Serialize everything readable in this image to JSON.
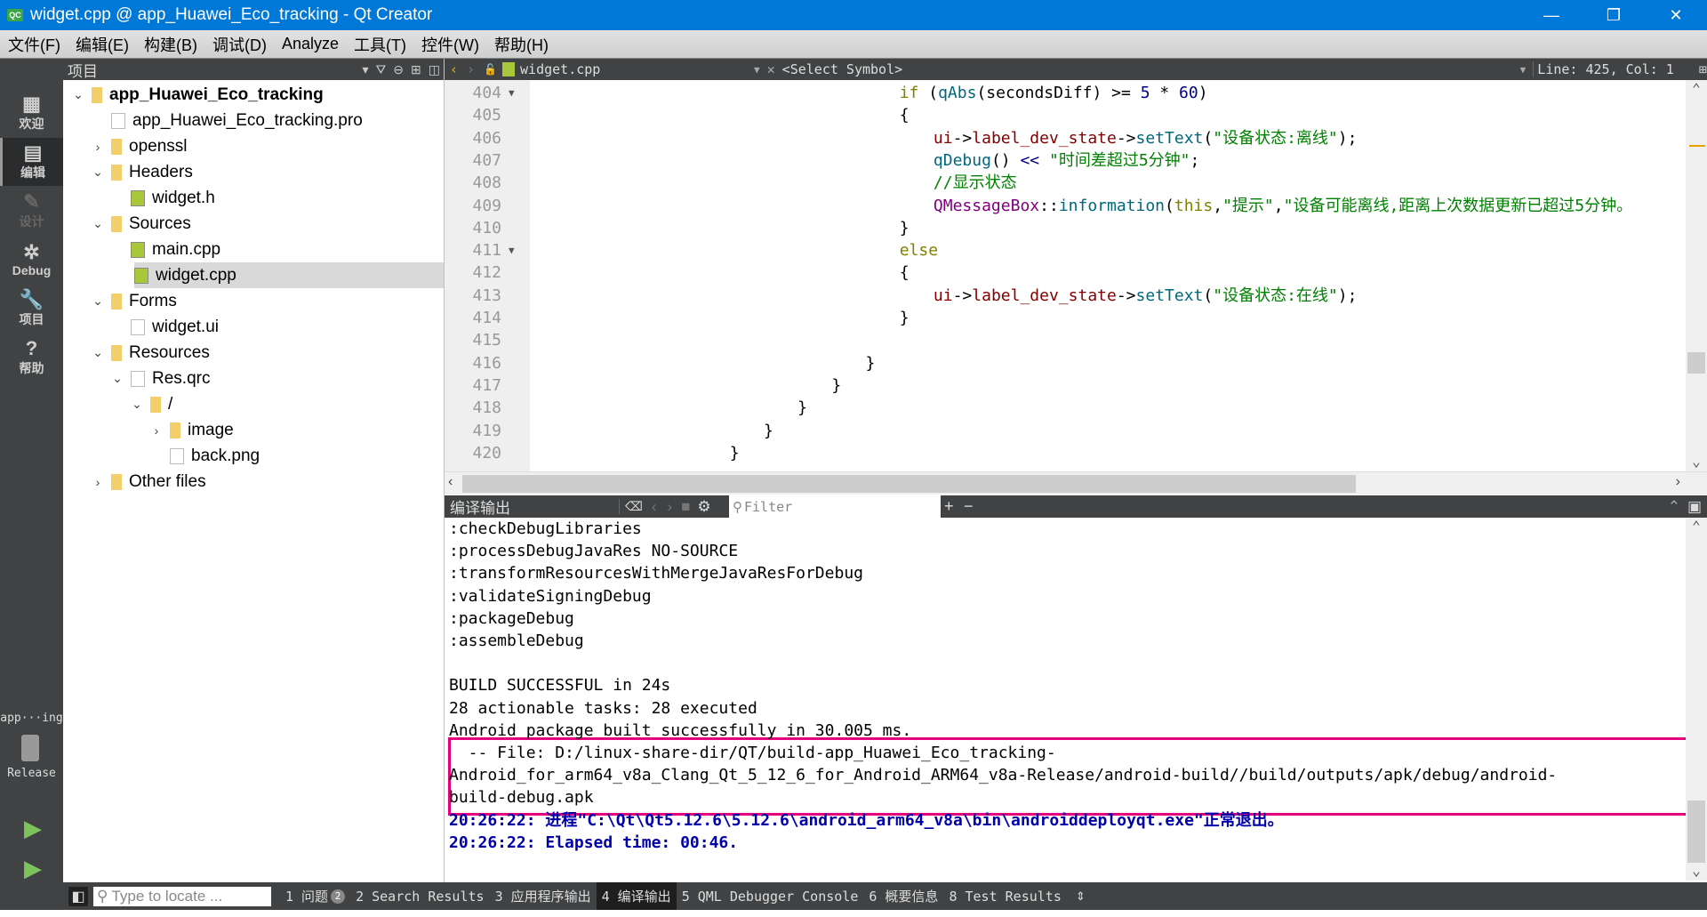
{
  "window": {
    "title": "widget.cpp @ app_Huawei_Eco_tracking - Qt Creator",
    "logo": "QC",
    "minimize": "—",
    "restore": "❐",
    "close": "✕"
  },
  "menu": [
    "文件(F)",
    "编辑(E)",
    "构建(B)",
    "调试(D)",
    "Analyze",
    "工具(T)",
    "控件(W)",
    "帮助(H)"
  ],
  "modes": [
    {
      "label": "欢迎",
      "icon": "grid-icon",
      "glyph": "▦"
    },
    {
      "label": "编辑",
      "icon": "edit-icon",
      "glyph": "▤",
      "active": true
    },
    {
      "label": "设计",
      "icon": "design-pencil-icon",
      "glyph": "✎",
      "disabled": true
    },
    {
      "label": "Debug",
      "icon": "bug-icon",
      "glyph": "✲"
    },
    {
      "label": "项目",
      "icon": "wrench-icon",
      "glyph": "🔧"
    },
    {
      "label": "帮助",
      "icon": "help-icon",
      "glyph": "?"
    }
  ],
  "kit": {
    "project": "app···ing",
    "build": "Release"
  },
  "project_panel": {
    "title": "项目",
    "tree": [
      {
        "label": "app_Huawei_Eco_tracking",
        "level": 0,
        "arrow": "⌄",
        "bold": true,
        "type": "project"
      },
      {
        "label": "app_Huawei_Eco_tracking.pro",
        "level": 1,
        "arrow": "",
        "type": "pro"
      },
      {
        "label": "openssl",
        "level": 1,
        "arrow": "›",
        "type": "folder"
      },
      {
        "label": "Headers",
        "level": 1,
        "arrow": "⌄",
        "type": "folder-h"
      },
      {
        "label": "widget.h",
        "level": 2,
        "arrow": "",
        "type": "src"
      },
      {
        "label": "Sources",
        "level": 1,
        "arrow": "⌄",
        "type": "folder-cpp"
      },
      {
        "label": "main.cpp",
        "level": 2,
        "arrow": "",
        "type": "src"
      },
      {
        "label": "widget.cpp",
        "level": 2,
        "arrow": "",
        "type": "src",
        "selected": true
      },
      {
        "label": "Forms",
        "level": 1,
        "arrow": "⌄",
        "type": "folder-form"
      },
      {
        "label": "widget.ui",
        "level": 2,
        "arrow": "",
        "type": "ui"
      },
      {
        "label": "Resources",
        "level": 1,
        "arrow": "⌄",
        "type": "folder-res"
      },
      {
        "label": "Res.qrc",
        "level": 2,
        "arrow": "⌄",
        "type": "qrc"
      },
      {
        "label": "/",
        "level": 3,
        "arrow": "⌄",
        "type": "folder"
      },
      {
        "label": "image",
        "level": 4,
        "arrow": "›",
        "type": "folder"
      },
      {
        "label": "back.png",
        "level": 4,
        "arrow": "",
        "type": "image"
      },
      {
        "label": "Other files",
        "level": 1,
        "arrow": "›",
        "type": "folder-other"
      }
    ]
  },
  "editor": {
    "file": "widget.cpp",
    "symbol": "<Select Symbol>",
    "cursor": "Line: 425, Col: 1",
    "lines": [
      {
        "n": "404",
        "fold": true,
        "indent": 16,
        "html": [
          [
            "kw",
            "if"
          ],
          [
            "",
            " ("
          ],
          [
            "fn",
            "qAbs"
          ],
          [
            "",
            "(secondsDiff) >= "
          ],
          [
            "num",
            "5"
          ],
          [
            "",
            " * "
          ],
          [
            "num",
            "60"
          ],
          [
            "",
            ")"
          ]
        ]
      },
      {
        "n": "405",
        "indent": 16,
        "html": [
          [
            "",
            "{"
          ]
        ]
      },
      {
        "n": "406",
        "indent": 20,
        "html": [
          [
            "mem",
            "ui"
          ],
          [
            "",
            "->"
          ],
          [
            "mem",
            "label_dev_state"
          ],
          [
            "",
            "->"
          ],
          [
            "fn",
            "setText"
          ],
          [
            "",
            "("
          ],
          [
            "str",
            "\"设备状态:离线\""
          ],
          [
            "",
            ");"
          ]
        ]
      },
      {
        "n": "407",
        "indent": 20,
        "html": [
          [
            "fn",
            "qDebug"
          ],
          [
            "",
            "() "
          ],
          [
            "num",
            "<<"
          ],
          [
            "",
            " "
          ],
          [
            "str",
            "\"时间差超过5分钟\""
          ],
          [
            "",
            ";"
          ]
        ]
      },
      {
        "n": "408",
        "indent": 20,
        "html": [
          [
            "cm",
            "//显示状态"
          ]
        ]
      },
      {
        "n": "409",
        "indent": 20,
        "html": [
          [
            "cls",
            "QMessageBox"
          ],
          [
            "",
            "::"
          ],
          [
            "fn",
            "information"
          ],
          [
            "",
            "("
          ],
          [
            "kw",
            "this"
          ],
          [
            "",
            ","
          ],
          [
            "str",
            "\"提示\""
          ],
          [
            "",
            ","
          ],
          [
            "str",
            "\"设备可能离线,距离上次数据更新已超过5分钟。"
          ]
        ]
      },
      {
        "n": "410",
        "indent": 16,
        "html": [
          [
            "",
            "}"
          ]
        ]
      },
      {
        "n": "411",
        "fold": true,
        "indent": 16,
        "html": [
          [
            "kw",
            "else"
          ]
        ]
      },
      {
        "n": "412",
        "indent": 16,
        "html": [
          [
            "",
            "{"
          ]
        ]
      },
      {
        "n": "413",
        "indent": 20,
        "html": [
          [
            "mem",
            "ui"
          ],
          [
            "",
            "->"
          ],
          [
            "mem",
            "label_dev_state"
          ],
          [
            "",
            "->"
          ],
          [
            "fn",
            "setText"
          ],
          [
            "",
            "("
          ],
          [
            "str",
            "\"设备状态:在线\""
          ],
          [
            "",
            ");"
          ]
        ]
      },
      {
        "n": "414",
        "indent": 16,
        "html": [
          [
            "",
            "}"
          ]
        ]
      },
      {
        "n": "415",
        "indent": 0,
        "html": []
      },
      {
        "n": "416",
        "indent": 12,
        "html": [
          [
            "",
            "}"
          ]
        ]
      },
      {
        "n": "417",
        "indent": 8,
        "html": [
          [
            "",
            "}"
          ]
        ]
      },
      {
        "n": "418",
        "indent": 4,
        "html": [
          [
            "",
            "}"
          ]
        ]
      },
      {
        "n": "419",
        "indent": 0,
        "html": [
          [
            "",
            "}"
          ]
        ]
      },
      {
        "n": "420",
        "indent": -4,
        "html": [
          [
            "",
            "}"
          ]
        ]
      }
    ]
  },
  "output": {
    "title": "编译输出",
    "filter_placeholder": "Filter",
    "lines": [
      {
        "text": ":checkDebugLibraries"
      },
      {
        "text": ":processDebugJavaRes NO-SOURCE"
      },
      {
        "text": ":transformResourcesWithMergeJavaResForDebug"
      },
      {
        "text": ":validateSigningDebug"
      },
      {
        "text": ":packageDebug"
      },
      {
        "text": ":assembleDebug"
      },
      {
        "text": ""
      },
      {
        "text": "BUILD SUCCESSFUL in 24s"
      },
      {
        "text": "28 actionable tasks: 28 executed"
      },
      {
        "text": "Android package built successfully in 30.005 ms."
      },
      {
        "text": "  -- File: D:/linux-share-dir/QT/build-app_Huawei_Eco_tracking-"
      },
      {
        "text": "Android_for_arm64_v8a_Clang_Qt_5_12_6_for_Android_ARM64_v8a-Release/android-build//build/outputs/apk/debug/android-"
      },
      {
        "text": "build-debug.apk"
      },
      {
        "text": "20:26:22: 进程\"C:\\Qt\\Qt5.12.6\\5.12.6\\android_arm64_v8a\\bin\\androiddeployqt.exe\"正常退出。",
        "blue": true
      },
      {
        "text": "20:26:22: Elapsed time: 00:46.",
        "blue": true
      }
    ]
  },
  "bottombar": {
    "locator_placeholder": "Type to locate ...",
    "tabs": [
      {
        "label": "1 问题",
        "badge": "2"
      },
      {
        "label": "2 Search Results"
      },
      {
        "label": "3 应用程序输出"
      },
      {
        "label": "4 编译输出",
        "active": true
      },
      {
        "label": "5 QML Debugger Console"
      },
      {
        "label": "6 概要信息"
      },
      {
        "label": "8 Test Results"
      }
    ]
  }
}
